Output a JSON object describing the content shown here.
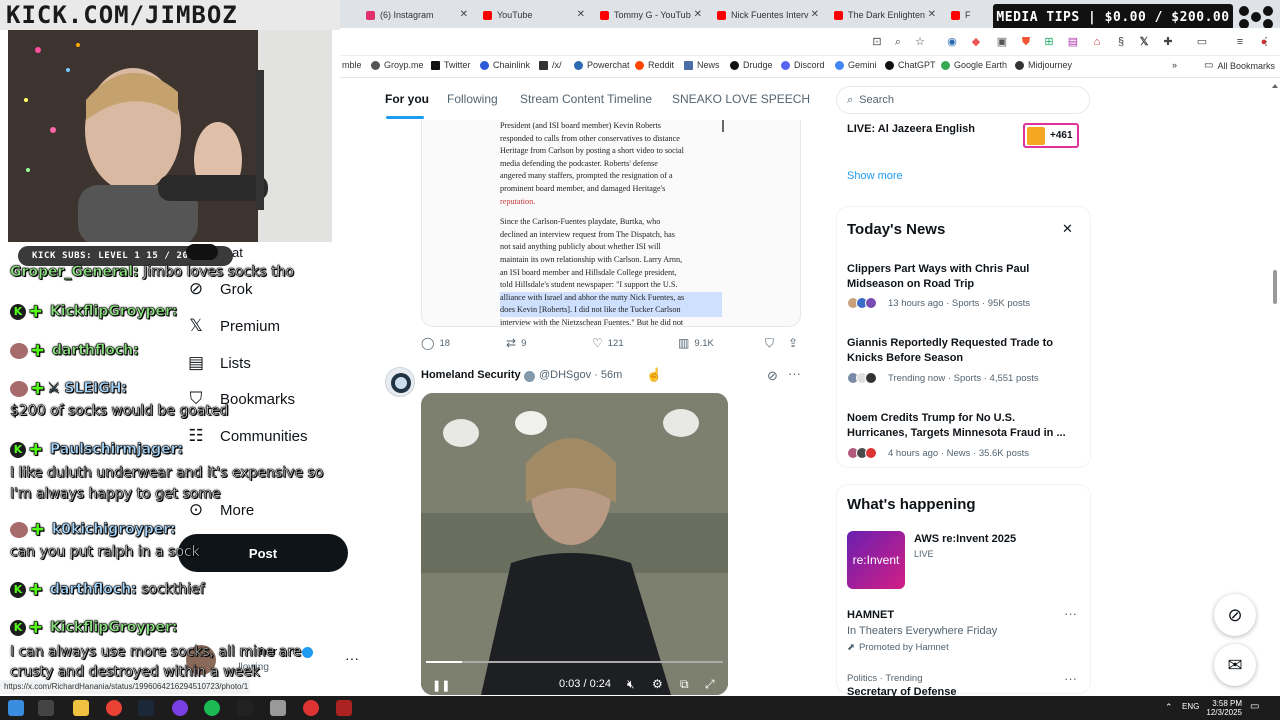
{
  "overlay": {
    "kick_url": "KICK.COM/JIMBOZ",
    "media_tips": "MEDIA TIPS | $0.00 / $200.00",
    "subs_bar": "KICK SUBS: LEVEL 1 15 / 20"
  },
  "browser": {
    "tabs": [
      {
        "label": "(6) Instagram",
        "color": "#e1306c"
      },
      {
        "label": "YouTube",
        "color": "#ff0000"
      },
      {
        "label": "Tommy G - YouTub",
        "color": "#ff0000"
      },
      {
        "label": "Nick Fuentes Interv",
        "color": "#ff0000"
      },
      {
        "label": "The Dark Enlighten",
        "color": "#ff0000"
      },
      {
        "label": "F",
        "color": "#ff0000"
      }
    ],
    "bookmarks": [
      {
        "label": "mble",
        "color": ""
      },
      {
        "label": "Groyp.me",
        "color": "#555"
      },
      {
        "label": "Twitter",
        "color": "#111"
      },
      {
        "label": "Chainlink",
        "color": "#2a5ada"
      },
      {
        "label": "/x/",
        "color": "#333"
      },
      {
        "label": "Powerchat",
        "color": "#2b6cb0"
      },
      {
        "label": "Reddit",
        "color": "#ff4500"
      },
      {
        "label": "News",
        "color": "#4a6da7"
      },
      {
        "label": "Drudge",
        "color": "#111"
      },
      {
        "label": "Discord",
        "color": "#5865f2"
      },
      {
        "label": "Gemini",
        "color": "#4285f4"
      },
      {
        "label": "ChatGPT",
        "color": "#111"
      },
      {
        "label": "Google Earth",
        "color": "#34a853"
      },
      {
        "label": "Midjourney",
        "color": "#333"
      }
    ],
    "all_bookmarks": "All Bookmarks",
    "status_url": "https://x.com/RichardHanania/status/1996064216294510723/photo/1"
  },
  "nav": {
    "partial_top": "at",
    "items": [
      {
        "label": "Grok",
        "icon": "grok-icon"
      },
      {
        "label": "Premium",
        "icon": "x-logo-icon"
      },
      {
        "label": "Lists",
        "icon": "lists-icon"
      },
      {
        "label": "Bookmarks",
        "icon": "bookmark-icon"
      },
      {
        "label": "Communities",
        "icon": "communities-icon"
      },
      {
        "label": "More",
        "icon": "more-icon"
      }
    ],
    "post_button": "Post",
    "account_fragment": "her",
    "account_sub": "...llowing"
  },
  "chat": [
    {
      "user": "Groper_General:",
      "msg": "Jimbo loves socks tho",
      "badges": "partial"
    },
    {
      "user": "KickflipGroyper:",
      "msg": "",
      "badges": "k-plus"
    },
    {
      "user": "darthfloch:",
      "msg": "",
      "badges": "d-plus"
    },
    {
      "user": "SLEIGH:",
      "msg": "$200 of socks would be goated",
      "badges": "d-plus-sword"
    },
    {
      "user": "Paulschirmjager:",
      "msg": "I like duluth underwear and it's expensive so I'm always happy to get some",
      "badges": "k-plus"
    },
    {
      "user": "k0kichigroyper:",
      "msg": "can you put ralph in a sock",
      "badges": "d-plus"
    },
    {
      "user": "darthfloch:",
      "msg": "sockthief",
      "badges": "k-plus"
    },
    {
      "user": "KickflipGroyper:",
      "msg": "I can always use more socks, all mine are crusty and destroyed within a week",
      "badges": "k-plus"
    }
  ],
  "feed": {
    "tabs": [
      "For you",
      "Following",
      "Stream Content Timeline",
      "SNEAKO LOVE SPEECH"
    ],
    "article_lines": [
      {
        "t": "President (and ISI board member) Kevin Roberts",
        "s": ""
      },
      {
        "t": "responded to calls from other conservatives to distance",
        "s": ""
      },
      {
        "t": "Heritage from Carlson by posting a short video to social",
        "s": ""
      },
      {
        "t": "media defending the podcaster. Roberts' defense",
        "s": ""
      },
      {
        "t": "angered many staffers, prompted the resignation of a",
        "s": "red-start"
      },
      {
        "t": "prominent board member, and damaged Heritage's",
        "s": "red-end"
      },
      {
        "t": "reputation.",
        "s": "red"
      },
      {
        "t": "",
        "s": "gap"
      },
      {
        "t": "Since the Carlson-Fuentes playdate, Burtka, who",
        "s": ""
      },
      {
        "t": "declined an interview request from The Dispatch, has",
        "s": ""
      },
      {
        "t": "not said anything publicly about whether ISI will",
        "s": ""
      },
      {
        "t": "maintain its own relationship with Carlson. Larry Arnn,",
        "s": ""
      },
      {
        "t": "an ISI board member and Hillsdale College president,",
        "s": ""
      },
      {
        "t": "told Hillsdale's student newspaper: \"I support the U.S.",
        "s": "hl-end"
      },
      {
        "t": "alliance with Israel and abhor the nutty Nick Fuentes, as",
        "s": "hl"
      },
      {
        "t": "does Kevin [Roberts]. I did not like the Tucker Carlson",
        "s": "hl"
      },
      {
        "t": "interview with the Nietzschean Fuentes.\" But he did not",
        "s": "hl-start"
      }
    ],
    "tweet1_actions": {
      "replies": "18",
      "reposts": "9",
      "likes": "121",
      "views": "9.1K"
    },
    "tweet2": {
      "name": "Homeland Security",
      "handle": "@DHSgov · 56m",
      "video_time": "0:03 / 0:24"
    }
  },
  "sidebar": {
    "search_placeholder": "Search",
    "live_title": "LIVE: Al Jazeera English",
    "live_badge": "+461",
    "show_more": "Show more",
    "todays_news": "Today's News",
    "news": [
      {
        "title": "Clippers Part Ways with Chris Paul Midseason on Road Trip",
        "meta": "13 hours ago · Sports · 95K posts"
      },
      {
        "title": "Giannis Reportedly Requested Trade to Knicks Before Season",
        "meta": "Trending now · Sports · 4,551 posts"
      },
      {
        "title": "Noem Credits Trump for No U.S. Hurricanes, Targets Minnesota Fraud in ...",
        "meta": "4 hours ago · News · 35.6K posts"
      }
    ],
    "whats_happening": "What's happening",
    "aws_title": "AWS re:Invent 2025",
    "aws_live": "LIVE",
    "aws_thumb_text": "re:Invent",
    "hamnet_title": "HAMNET",
    "hamnet_sub": "In Theaters Everywhere Friday",
    "hamnet_promo": "Promoted by Hamnet",
    "politics_meta": "Politics · Trending",
    "politics_title": "Secretary of Defense"
  },
  "taskbar": {
    "lang": "ENG",
    "time": "3:58 PM",
    "date": "12/3/2025"
  }
}
